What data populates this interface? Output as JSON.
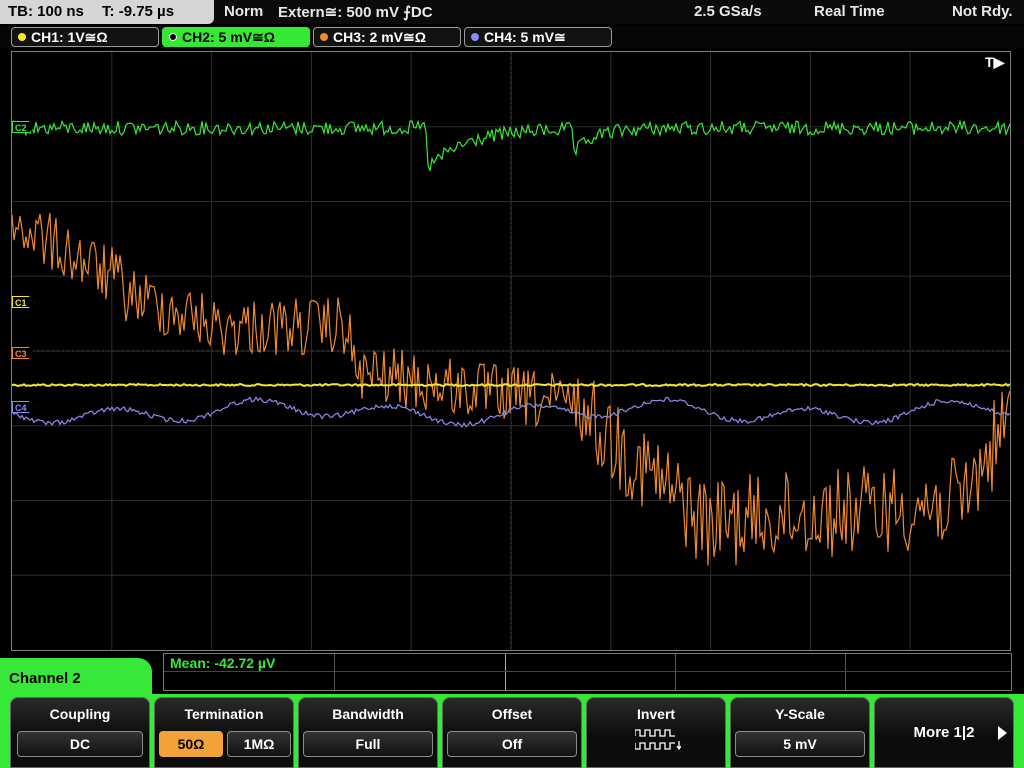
{
  "status": {
    "tb": "TB: 100 ns",
    "t": "T: -9.75 µs",
    "mode": "Norm",
    "trigger": "Extern≅: 500 mV ⨍DC",
    "samplerate": "2.5 GSa/s",
    "acq": "Real Time",
    "state": "Not Rdy."
  },
  "channels": [
    {
      "label": "CH1: 1V≅Ω",
      "color": "#f2e832"
    },
    {
      "label": "CH2: 5 mV≅Ω",
      "color": "#3ae83a"
    },
    {
      "label": "CH3: 2 mV≅Ω",
      "color": "#f08a30"
    },
    {
      "label": "CH4: 5 mV≅",
      "color": "#8c8cf0"
    }
  ],
  "markers": {
    "c1": "C1",
    "c2": "C2",
    "c3": "C3",
    "c4": "C4"
  },
  "trigger_marker": "T",
  "measurement": "Mean: -42.72 µV",
  "panel": {
    "title": "Channel 2",
    "coupling": {
      "title": "Coupling",
      "value": "DC"
    },
    "termination": {
      "title": "Termination",
      "opt1": "50Ω",
      "opt2": "1MΩ"
    },
    "bandwidth": {
      "title": "Bandwidth",
      "value": "Full"
    },
    "offset": {
      "title": "Offset",
      "value": "Off"
    },
    "invert": {
      "title": "Invert"
    },
    "yscale": {
      "title": "Y-Scale",
      "value": "5 mV"
    },
    "more": "More 1|2"
  }
}
